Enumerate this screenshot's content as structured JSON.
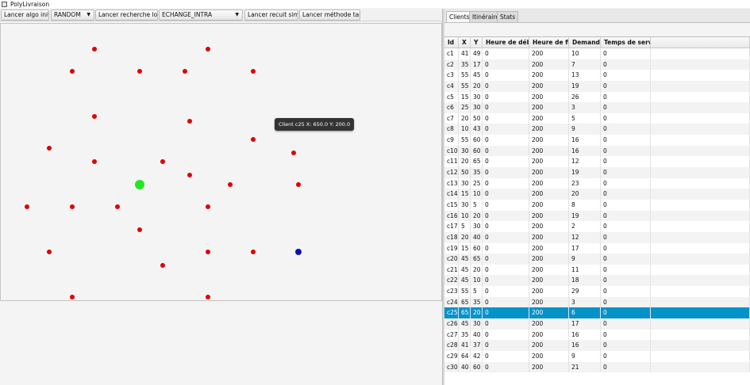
{
  "window": {
    "title": "PolyLivraison"
  },
  "toolbar": {
    "initial_algo_label": "Lancer algo initial",
    "strategy_value": "RANDOM",
    "local_search_label": "Lancer recherche locale",
    "neighborhood_value": "ECHANGE_INTRA",
    "annealing_label": "Lancer recuit simulé",
    "tabu_label": "Lancer méthode tabou"
  },
  "tooltip": {
    "text": "Client c25 X: 650.0 Y: 200.0"
  },
  "tabs": [
    "Clients",
    "Itinéraires",
    "Stats"
  ],
  "active_tab": "Clients",
  "colors": {
    "client_dot": "#e00000",
    "depot_dot": "#22e822",
    "selected_dot": "#1010b0",
    "selected_row": "#0493c9"
  },
  "table": {
    "headers": [
      "Id",
      "X",
      "Y",
      "Heure de début",
      "Heure de fin",
      "Demande",
      "Temps de service"
    ],
    "selected_row": "c25",
    "rows": [
      [
        "c1",
        "41",
        "49",
        "0",
        "200",
        "10",
        "0"
      ],
      [
        "c2",
        "35",
        "17",
        "0",
        "200",
        "7",
        "0"
      ],
      [
        "c3",
        "55",
        "45",
        "0",
        "200",
        "13",
        "0"
      ],
      [
        "c4",
        "55",
        "20",
        "0",
        "200",
        "19",
        "0"
      ],
      [
        "c5",
        "15",
        "30",
        "0",
        "200",
        "26",
        "0"
      ],
      [
        "c6",
        "25",
        "30",
        "0",
        "200",
        "3",
        "0"
      ],
      [
        "c7",
        "20",
        "50",
        "0",
        "200",
        "5",
        "0"
      ],
      [
        "c8",
        "10",
        "43",
        "0",
        "200",
        "9",
        "0"
      ],
      [
        "c9",
        "55",
        "60",
        "0",
        "200",
        "16",
        "0"
      ],
      [
        "c10",
        "30",
        "60",
        "0",
        "200",
        "16",
        "0"
      ],
      [
        "c11",
        "20",
        "65",
        "0",
        "200",
        "12",
        "0"
      ],
      [
        "c12",
        "50",
        "35",
        "0",
        "200",
        "19",
        "0"
      ],
      [
        "c13",
        "30",
        "25",
        "0",
        "200",
        "23",
        "0"
      ],
      [
        "c14",
        "15",
        "10",
        "0",
        "200",
        "20",
        "0"
      ],
      [
        "c15",
        "30",
        "5",
        "0",
        "200",
        "8",
        "0"
      ],
      [
        "c16",
        "10",
        "20",
        "0",
        "200",
        "19",
        "0"
      ],
      [
        "c17",
        "5",
        "30",
        "0",
        "200",
        "2",
        "0"
      ],
      [
        "c18",
        "20",
        "40",
        "0",
        "200",
        "12",
        "0"
      ],
      [
        "c19",
        "15",
        "60",
        "0",
        "200",
        "17",
        "0"
      ],
      [
        "c20",
        "45",
        "65",
        "0",
        "200",
        "9",
        "0"
      ],
      [
        "c21",
        "45",
        "20",
        "0",
        "200",
        "11",
        "0"
      ],
      [
        "c22",
        "45",
        "10",
        "0",
        "200",
        "18",
        "0"
      ],
      [
        "c23",
        "55",
        "5",
        "0",
        "200",
        "29",
        "0"
      ],
      [
        "c24",
        "65",
        "35",
        "0",
        "200",
        "3",
        "0"
      ],
      [
        "c25",
        "65",
        "20",
        "0",
        "200",
        "6",
        "0"
      ],
      [
        "c26",
        "45",
        "30",
        "0",
        "200",
        "17",
        "0"
      ],
      [
        "c27",
        "35",
        "40",
        "0",
        "200",
        "16",
        "0"
      ],
      [
        "c28",
        "41",
        "37",
        "0",
        "200",
        "16",
        "0"
      ],
      [
        "c29",
        "64",
        "42",
        "0",
        "200",
        "9",
        "0"
      ],
      [
        "c30",
        "40",
        "60",
        "0",
        "200",
        "21",
        "0"
      ]
    ]
  }
}
